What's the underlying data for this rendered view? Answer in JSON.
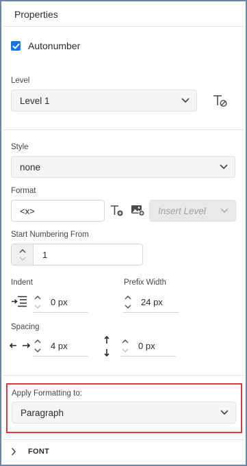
{
  "panel": {
    "title": "Properties"
  },
  "autonumber": {
    "label": "Autonumber",
    "checked": true
  },
  "level": {
    "label": "Level",
    "value": "Level 1",
    "clear_icon": "clear-formatting-icon"
  },
  "style": {
    "label": "Style",
    "value": "none"
  },
  "format": {
    "label": "Format",
    "value": "<x>",
    "insert_placeholder": "Insert Level",
    "icons": [
      "insert-text-icon",
      "insert-image-icon"
    ]
  },
  "start_numbering": {
    "label": "Start Numbering From",
    "value": "1"
  },
  "indent": {
    "label": "Indent",
    "value": "0 px",
    "icon": "indent-icon"
  },
  "prefix_width": {
    "label": "Prefix Width",
    "value": "24 px"
  },
  "spacing": {
    "label": "Spacing",
    "horizontal_value": "4 px",
    "vertical_value": "0 px",
    "icons": [
      "horizontal-spacing-icon",
      "vertical-spacing-icon"
    ]
  },
  "apply_formatting": {
    "label": "Apply Formatting to:",
    "value": "Paragraph"
  },
  "font_section": {
    "label": "FONT"
  },
  "colors": {
    "accent": "#1473e6",
    "highlight": "#d9363e",
    "border": "#6b86a8"
  }
}
